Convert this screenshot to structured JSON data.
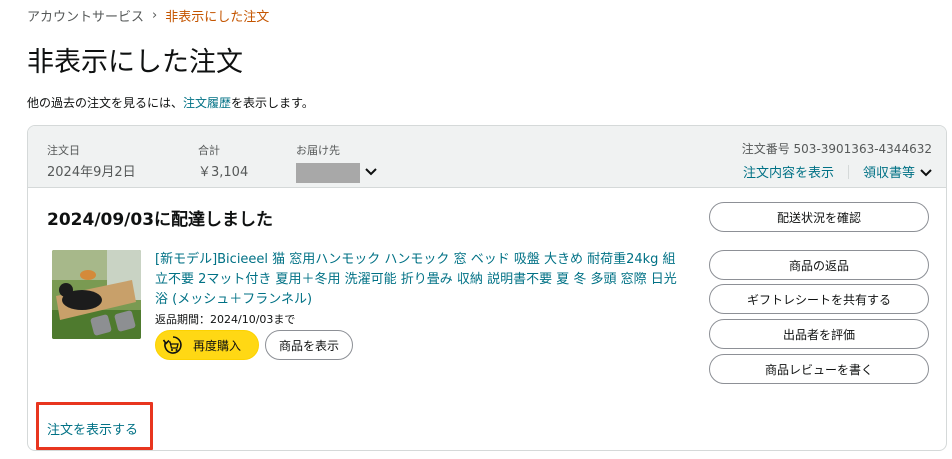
{
  "breadcrumb": {
    "parent": "アカウントサービス",
    "separator": "›",
    "current": "非表示にした注文"
  },
  "page": {
    "title": "非表示にした注文",
    "subtext_before": "他の過去の注文を見るには、",
    "subtext_link": "注文履歴",
    "subtext_after": "を表示します。"
  },
  "order": {
    "date_label": "注文日",
    "date_value": "2024年9月2日",
    "total_label": "合計",
    "total_value": "￥3,104",
    "ship_label": "お届け先",
    "order_number": "注文番号 503-3901363-4344632",
    "view_details": "注文内容を表示",
    "receipt": "領収書等",
    "delivery_status": "2024/09/03に配達しました",
    "product_title": "[新モデル]Bicieeel 猫 窓用ハンモック ハンモック 窓 ベッド 吸盤 大きめ 耐荷重24kg 組立不要 2マット付き 夏用＋冬用 洗濯可能 折り畳み 収納 説明書不要 夏 冬 多頭 窓際 日光浴 (メッシュ＋フランネル)",
    "return_period": "返品期間：2024/10/03まで",
    "rebuy_label": "再度購入",
    "view_item_label": "商品を表示",
    "side_buttons": {
      "track": "配送状況を確認",
      "return": "商品の返品",
      "gift_receipt": "ギフトレシートを共有する",
      "rate_seller": "出品者を評価",
      "review": "商品レビューを書く"
    },
    "view_order_link": "注文を表示する"
  },
  "colors": {
    "link": "#007185",
    "breadcrumb_current": "#c45500",
    "rebuy_button": "#ffd814",
    "header_bg": "#f0f2f2",
    "highlight": "#e8351f"
  },
  "icons": {
    "rebuy": "rebuy-cart-icon",
    "chevron": "chevron-down-icon"
  }
}
